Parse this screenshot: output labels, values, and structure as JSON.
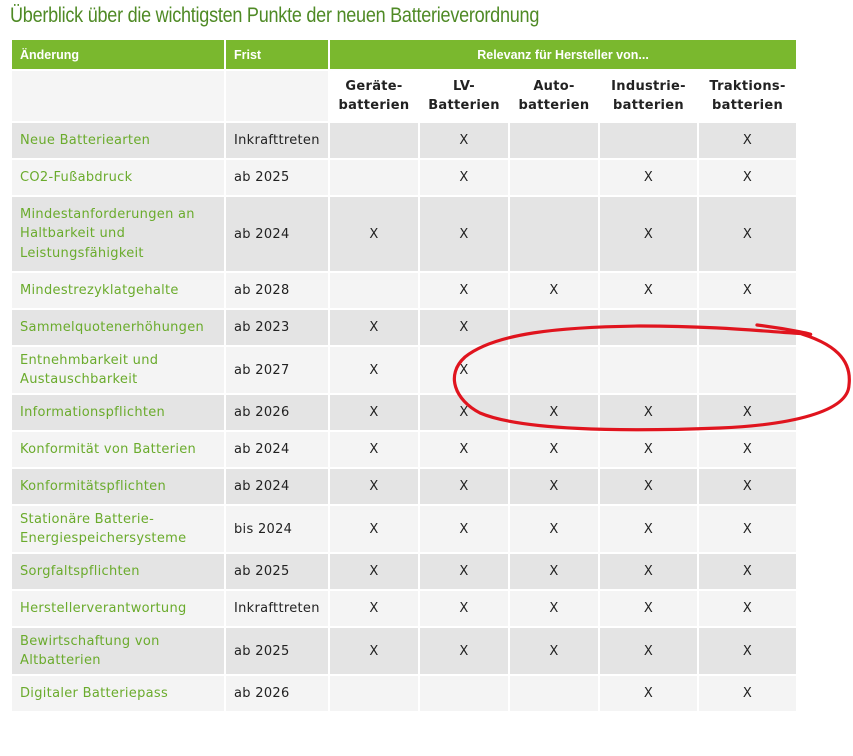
{
  "title": "Überblick über die wichtigsten Punkte der neuen Batterieverordnung",
  "header": {
    "change": "Änderung",
    "deadline": "Frist",
    "relevance": "Relevanz für Hersteller von..."
  },
  "subheaders": [
    {
      "l1": "Geräte-",
      "l2": "batterien"
    },
    {
      "l1": "LV-",
      "l2": "Batterien"
    },
    {
      "l1": "Auto-",
      "l2": "batterien"
    },
    {
      "l1": "Industrie-",
      "l2": "batterien"
    },
    {
      "l1": "Traktions-",
      "l2": "batterien"
    }
  ],
  "rows": [
    {
      "name_lines": [
        "Neue Batteriearten"
      ],
      "deadline": "Inkrafttreten",
      "marks": [
        "",
        "X",
        "",
        "",
        "X"
      ]
    },
    {
      "name_lines": [
        "CO2-Fußabdruck"
      ],
      "deadline": "ab 2025",
      "marks": [
        "",
        "X",
        "",
        "X",
        "X"
      ]
    },
    {
      "name_lines": [
        "Mindestanforderungen an",
        "Haltbarkeit und",
        "Leistungsfähigkeit"
      ],
      "deadline": "ab 2024",
      "marks": [
        "X",
        "X",
        "",
        "X",
        "X"
      ]
    },
    {
      "name_lines": [
        "Mindestrezyklatgehalte"
      ],
      "deadline": "ab 2028",
      "marks": [
        "",
        "X",
        "X",
        "X",
        "X"
      ]
    },
    {
      "name_lines": [
        "Sammelquotenerhöhungen"
      ],
      "deadline": "ab 2023",
      "marks": [
        "X",
        "X",
        "",
        "",
        ""
      ]
    },
    {
      "name_lines": [
        "Entnehmbarkeit und",
        "Austauschbarkeit"
      ],
      "deadline": "ab 2027",
      "marks": [
        "X",
        "X",
        "",
        "",
        ""
      ]
    },
    {
      "name_lines": [
        "Informationspflichten"
      ],
      "deadline": "ab 2026",
      "marks": [
        "X",
        "X",
        "X",
        "X",
        "X"
      ]
    },
    {
      "name_lines": [
        "Konformität von Batterien"
      ],
      "deadline": "ab 2024",
      "marks": [
        "X",
        "X",
        "X",
        "X",
        "X"
      ]
    },
    {
      "name_lines": [
        "Konformitätspflichten"
      ],
      "deadline": "ab 2024",
      "marks": [
        "X",
        "X",
        "X",
        "X",
        "X"
      ]
    },
    {
      "name_lines": [
        "Stationäre Batterie-",
        "Energiespeichersysteme"
      ],
      "deadline": "bis 2024",
      "marks": [
        "X",
        "X",
        "X",
        "X",
        "X"
      ]
    },
    {
      "name_lines": [
        "Sorgfaltspflichten"
      ],
      "deadline": "ab 2025",
      "marks": [
        "X",
        "X",
        "X",
        "X",
        "X"
      ]
    },
    {
      "name_lines": [
        "Herstellerverantwortung"
      ],
      "deadline": "Inkrafttreten",
      "marks": [
        "X",
        "X",
        "X",
        "X",
        "X"
      ]
    },
    {
      "name_lines": [
        "Bewirtschaftung von",
        "Altbatterien"
      ],
      "deadline": "ab 2025",
      "marks": [
        "X",
        "X",
        "X",
        "X",
        "X"
      ]
    },
    {
      "name_lines": [
        "Digitaler Batteriepass"
      ],
      "deadline": "ab 2026",
      "marks": [
        "",
        "",
        "",
        "X",
        "X"
      ]
    }
  ],
  "colors": {
    "accent_green": "#7ab82e",
    "link_green": "#6aab2c",
    "title_green": "#4f8a25",
    "annotation_red": "#e0141e"
  }
}
